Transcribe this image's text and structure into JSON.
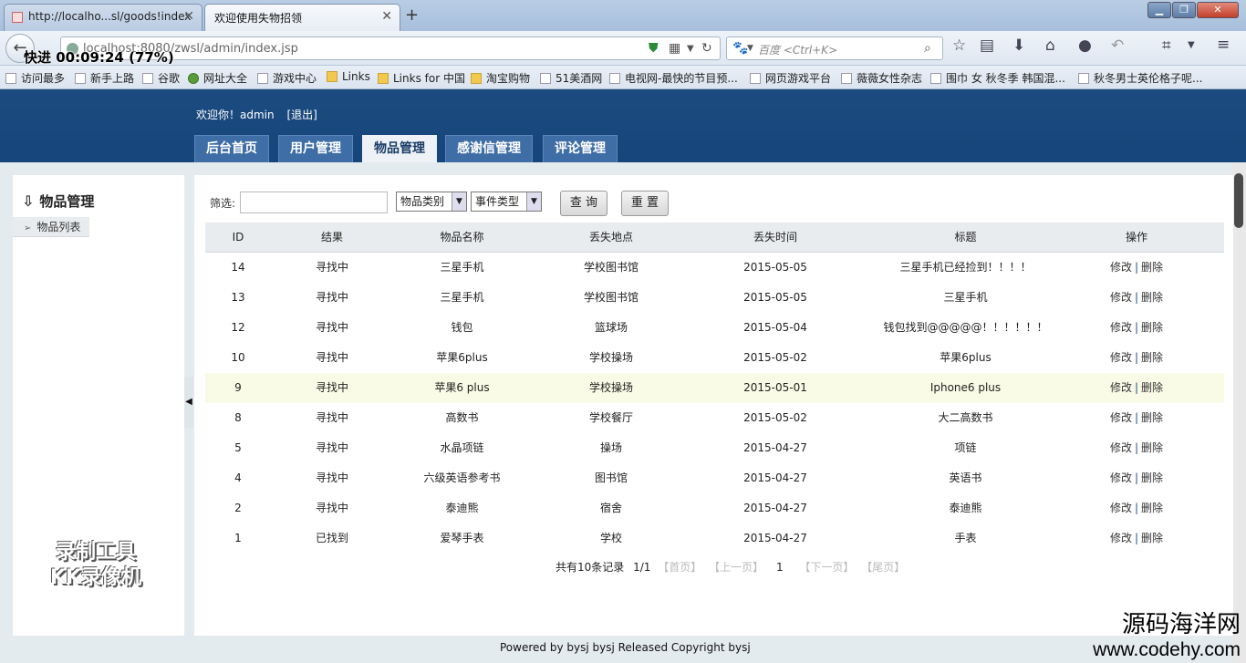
{
  "browser": {
    "tabs": [
      {
        "title": "http://localho...sl/goods!index"
      },
      {
        "title": "欢迎使用失物招领"
      }
    ],
    "url": "localhost:8080/zwsl/admin/index.jsp",
    "search_placeholder": "百度 <Ctrl+K>",
    "recorder_timer": "快进 00:09:24 (77%)",
    "bookmarks": [
      {
        "label": "访问最多",
        "icon": "page-icon"
      },
      {
        "label": "新手上路",
        "icon": "page-icon"
      },
      {
        "label": "谷歌",
        "icon": "page-icon"
      },
      {
        "label": "网址大全",
        "icon": "globe-icon"
      },
      {
        "label": "游戏中心",
        "icon": "page-icon"
      },
      {
        "label": "Links",
        "icon": "folder-icon"
      },
      {
        "label": "Links for 中国",
        "icon": "folder-icon"
      },
      {
        "label": "淘宝购物",
        "icon": "folder-icon"
      },
      {
        "label": "51美酒网",
        "icon": "page-icon"
      },
      {
        "label": "电视网-最快的节目预...",
        "icon": "page-icon"
      },
      {
        "label": "网页游戏平台",
        "icon": "page-icon"
      },
      {
        "label": "薇薇女性杂志",
        "icon": "page-icon"
      },
      {
        "label": "围巾 女 秋冬季 韩国混...",
        "icon": "page-icon"
      },
      {
        "label": "秋冬男士英伦格子呢...",
        "icon": "page-icon"
      }
    ]
  },
  "header": {
    "welcome": "欢迎你！admin",
    "logout": "[退出]",
    "nav": [
      {
        "label": "后台首页",
        "active": false
      },
      {
        "label": "用户管理",
        "active": false
      },
      {
        "label": "物品管理",
        "active": true
      },
      {
        "label": "感谢信管理",
        "active": false
      },
      {
        "label": "评论管理",
        "active": false
      }
    ]
  },
  "sidebar": {
    "title": "物品管理",
    "items": [
      {
        "label": "物品列表"
      }
    ]
  },
  "filter": {
    "label": "筛选:",
    "input_value": "",
    "category_select": "物品类别",
    "event_select": "事件类型",
    "query_button": "查 询",
    "reset_button": "重 置"
  },
  "table": {
    "columns": [
      "ID",
      "结果",
      "物品名称",
      "丢失地点",
      "丢失时间",
      "标题",
      "操作"
    ],
    "rows": [
      {
        "id": "14",
        "result": "寻找中",
        "name": "三星手机",
        "place": "学校图书馆",
        "time": "2015-05-05",
        "title": "三星手机已经捡到！！！！",
        "highlight": false
      },
      {
        "id": "13",
        "result": "寻找中",
        "name": "三星手机",
        "place": "学校图书馆",
        "time": "2015-05-05",
        "title": "三星手机",
        "highlight": false
      },
      {
        "id": "12",
        "result": "寻找中",
        "name": "钱包",
        "place": "篮球场",
        "time": "2015-05-04",
        "title": "钱包找到@@@@@！！！！！！",
        "highlight": false
      },
      {
        "id": "10",
        "result": "寻找中",
        "name": "苹果6plus",
        "place": "学校操场",
        "time": "2015-05-02",
        "title": "苹果6plus",
        "highlight": false
      },
      {
        "id": "9",
        "result": "寻找中",
        "name": "苹果6 plus",
        "place": "学校操场",
        "time": "2015-05-01",
        "title": "Iphone6 plus",
        "highlight": true
      },
      {
        "id": "8",
        "result": "寻找中",
        "name": "高数书",
        "place": "学校餐厅",
        "time": "2015-05-02",
        "title": "大二高数书",
        "highlight": false
      },
      {
        "id": "5",
        "result": "寻找中",
        "name": "水晶项链",
        "place": "操场",
        "time": "2015-04-27",
        "title": "项链",
        "highlight": false
      },
      {
        "id": "4",
        "result": "寻找中",
        "name": "六级英语参考书",
        "place": "图书馆",
        "time": "2015-04-27",
        "title": "英语书",
        "highlight": false
      },
      {
        "id": "2",
        "result": "寻找中",
        "name": "泰迪熊",
        "place": "宿舍",
        "time": "2015-04-27",
        "title": "泰迪熊",
        "highlight": false
      },
      {
        "id": "1",
        "result": "已找到",
        "name": "爱琴手表",
        "place": "学校",
        "time": "2015-04-27",
        "title": "手表",
        "highlight": false
      }
    ],
    "op_edit": "修改",
    "op_sep": "|",
    "op_delete": "删除"
  },
  "pager": {
    "total": "共有10条记录",
    "page": "1/1",
    "first": "【首页】",
    "prev": "【上一页】",
    "current": "1",
    "next": "【下一页】",
    "last": "【尾页】"
  },
  "footer": "Powered by bysj bysj Released  Copyright bysj",
  "watermarks": {
    "recorder_line1": "录制工具",
    "recorder_line2": "KK录像机",
    "site_cn": "源码海洋网",
    "site_url": "www.codehy.com"
  },
  "colors": {
    "header_bg": "#1a4a7f",
    "nav_tab_bg": "#3f6ea7",
    "content_bg": "#e4ebef",
    "highlight_row": "#fafbe6"
  }
}
